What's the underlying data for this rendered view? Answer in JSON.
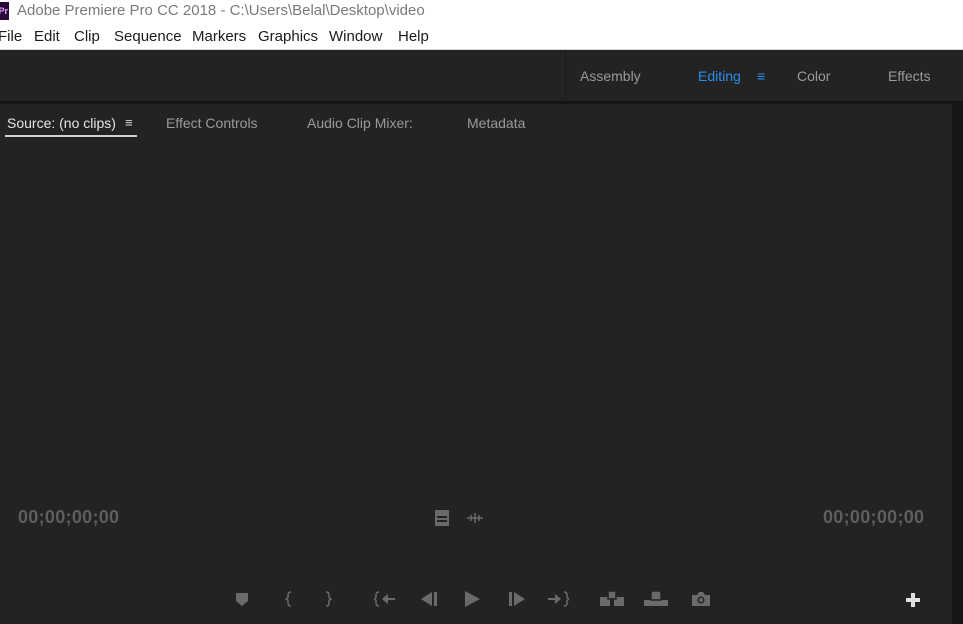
{
  "window": {
    "app_icon_label": "Pr",
    "title": "Adobe Premiere Pro CC 2018 - C:\\Users\\Belal\\Desktop\\video"
  },
  "menu": {
    "items": [
      "File",
      "Edit",
      "Clip",
      "Sequence",
      "Markers",
      "Graphics",
      "Window",
      "Help"
    ]
  },
  "workspaces": {
    "tabs": [
      "Assembly",
      "Editing",
      "Color",
      "Effects"
    ],
    "active": "Editing",
    "menu_icon": "≡"
  },
  "source_panel": {
    "tabs": [
      "Source: (no clips)",
      "Effect Controls",
      "Audio Clip Mixer:",
      "Metadata"
    ],
    "active_tab": "Source: (no clips)",
    "tab_menu_icon": "≡",
    "timecode_in": "00;00;00;00",
    "timecode_out": "00;00;00;00"
  },
  "controls": {
    "icons": [
      "drop-frame-icon",
      "audio-waveform-icon",
      "add-marker-icon",
      "mark-in-icon",
      "mark-out-icon",
      "go-to-in-icon",
      "step-back-icon",
      "play-icon",
      "step-forward-icon",
      "go-to-out-icon",
      "insert-icon",
      "overwrite-icon",
      "export-frame-icon",
      "button-editor-icon"
    ]
  },
  "colors": {
    "accent": "#2d8ceb",
    "panel_bg": "#232323",
    "timecode": "#5e5e5e"
  }
}
